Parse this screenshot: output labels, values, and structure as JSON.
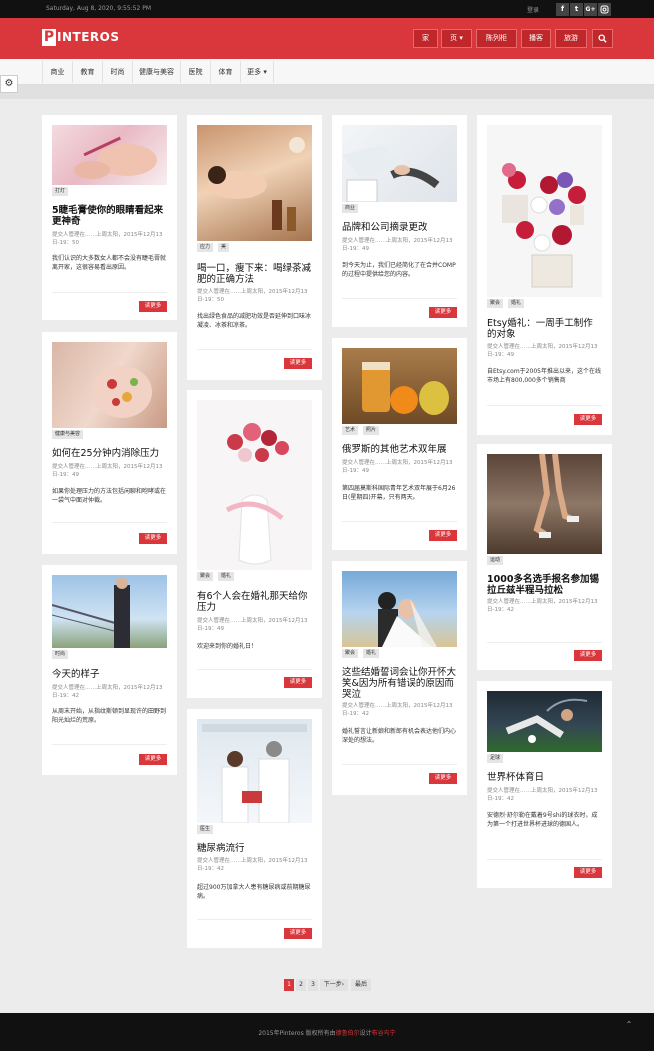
{
  "topbar": {
    "date": "Saturday, Aug 8, 2020, 9:55:52 PM",
    "login": "登录",
    "social": [
      "f",
      "t",
      "G+",
      " "
    ]
  },
  "header": {
    "logo_letter": "P",
    "logo_text": "INTEROS",
    "nav": [
      "家",
      "页 ▾",
      "陈列柜",
      "播客",
      "旅游"
    ]
  },
  "categories": [
    "商业",
    "教育",
    "时尚",
    "健康与美容",
    "医院",
    "体育",
    "更多 ▾"
  ],
  "cards": [
    {
      "tags": [
        "打灯"
      ],
      "title": "5睫毛膏使你的眼睛看起来更神奇",
      "meta": "提交人管理在……上周太阳，2015年12月13日-19：50",
      "excerpt": "我们认识的大多数女人都不会没有睫毛膏就离开家，这很容易看出原因。",
      "more": "读更多"
    },
    {
      "tags": [
        "应力",
        "美"
      ],
      "title": "喝一口，瘦下来：喝绿茶减肥的正确方法",
      "meta": "提交人管理在……上周太阳，2015年12月13日-19：50",
      "excerpt": "找出绿色食品的减肥功效是否延伸到口味冰凝凌、冰茶和凉茶。",
      "more": "读更多"
    },
    {
      "tags": [
        "商业"
      ],
      "title": "品牌和公司摘录更改",
      "meta": "提交人管理在……上周太阳，2015年12月13日-19：49",
      "excerpt": "到今天为止，我们已经简化了在合并COMP的过程中提供给您的内容。",
      "more": "读更多"
    },
    {
      "tags": [
        "聚会",
        "婚礼"
      ],
      "title": "Etsy婚礼：一周手工制作的对象",
      "meta": "提交人管理在……上周太阳，2015年12月13日-19：49",
      "excerpt": "自Etsy.com于2005年推出以来，这个在线市场上有800,000多个销售商",
      "more": "读更多"
    },
    {
      "tags": [
        "健康与美容"
      ],
      "title": "如何在25分钟内消除压力",
      "meta": "提交人管理在……上周太阳，2015年12月13日-19：49",
      "excerpt": "如果你处理压力的方法包括闲聊和咆哮或在一袋气中面对仲裁。",
      "more": "读更多"
    },
    {
      "tags": [
        "艺术",
        "照片"
      ],
      "title": "俄罗斯的其他艺术双年展",
      "meta": "提交人管理在……上周太阳，2015年12月13日-19：49",
      "excerpt": "第四届莫斯科国际青年艺术双年展于6月26日(星期四)开幕，只有两天。",
      "more": "读更多"
    },
    {
      "tags": [
        "聚会",
        "婚礼"
      ],
      "title": "有6个人会在婚礼那天给你压力",
      "meta": "提交人管理在……上周太阳，2015年12月13日-19：49",
      "excerpt": "欢迎来到你的婚礼日！",
      "more": "读更多"
    },
    {
      "tags": [
        "运动"
      ],
      "title": "1000多名选手报名参加锡拉丘兹半程马拉松",
      "meta": "提交人管理在……上周太阳，2015年12月13日-19：42",
      "excerpt": "",
      "more": "读更多"
    },
    {
      "tags": [
        "时尚"
      ],
      "title": "今天的样子",
      "meta": "提交人管理在……上周太阳，2015年12月13日-19：42",
      "excerpt": "从周末开始，从指纹斯顿到显现许的田野到阳光灿烂的荒原。",
      "more": "读更多"
    },
    {
      "tags": [
        "聚会",
        "婚礼"
      ],
      "title": "这些结婚誓词会让你开怀大笑&因为所有错误的原因而哭泣",
      "meta": "提交人管理在……上周太阳，2015年12月13日-19：42",
      "excerpt": "婚礼誓言让新娘和新郎有机会表达他们内心深处的想法。",
      "more": "读更多"
    },
    {
      "tags": [
        "足球"
      ],
      "title": "世界杯体育日",
      "meta": "提交人管理在……上周太阳，2015年12月13日-19：42",
      "excerpt": "安德烈·舒尔勒在戴着9号shi的球衣时，成为第一个打进世界杯进球的德国人。",
      "more": "读更多"
    },
    {
      "tags": [
        "医生"
      ],
      "title": "糖尿病流行",
      "meta": "提交人管理在……上周太阳，2015年12月13日-19：42",
      "excerpt": "超过900万加拿大人患有糖尿病或前期糖尿病。",
      "more": "读更多"
    }
  ],
  "pagination": [
    "1",
    "2",
    "3",
    "下一步›",
    "最后"
  ],
  "footer": {
    "prefix": "2015年Pinteros 版权所有由",
    "link1": "德鲁伯尔",
    "mid": "设计",
    "link2": "布谷鸟宁"
  },
  "colors": {
    "brand": "#d9373b",
    "topbar": "#111111",
    "footer": "#111111"
  },
  "icons": {
    "gear": "gear-icon",
    "search": "search-icon",
    "totop": "chevron-up-icon"
  }
}
